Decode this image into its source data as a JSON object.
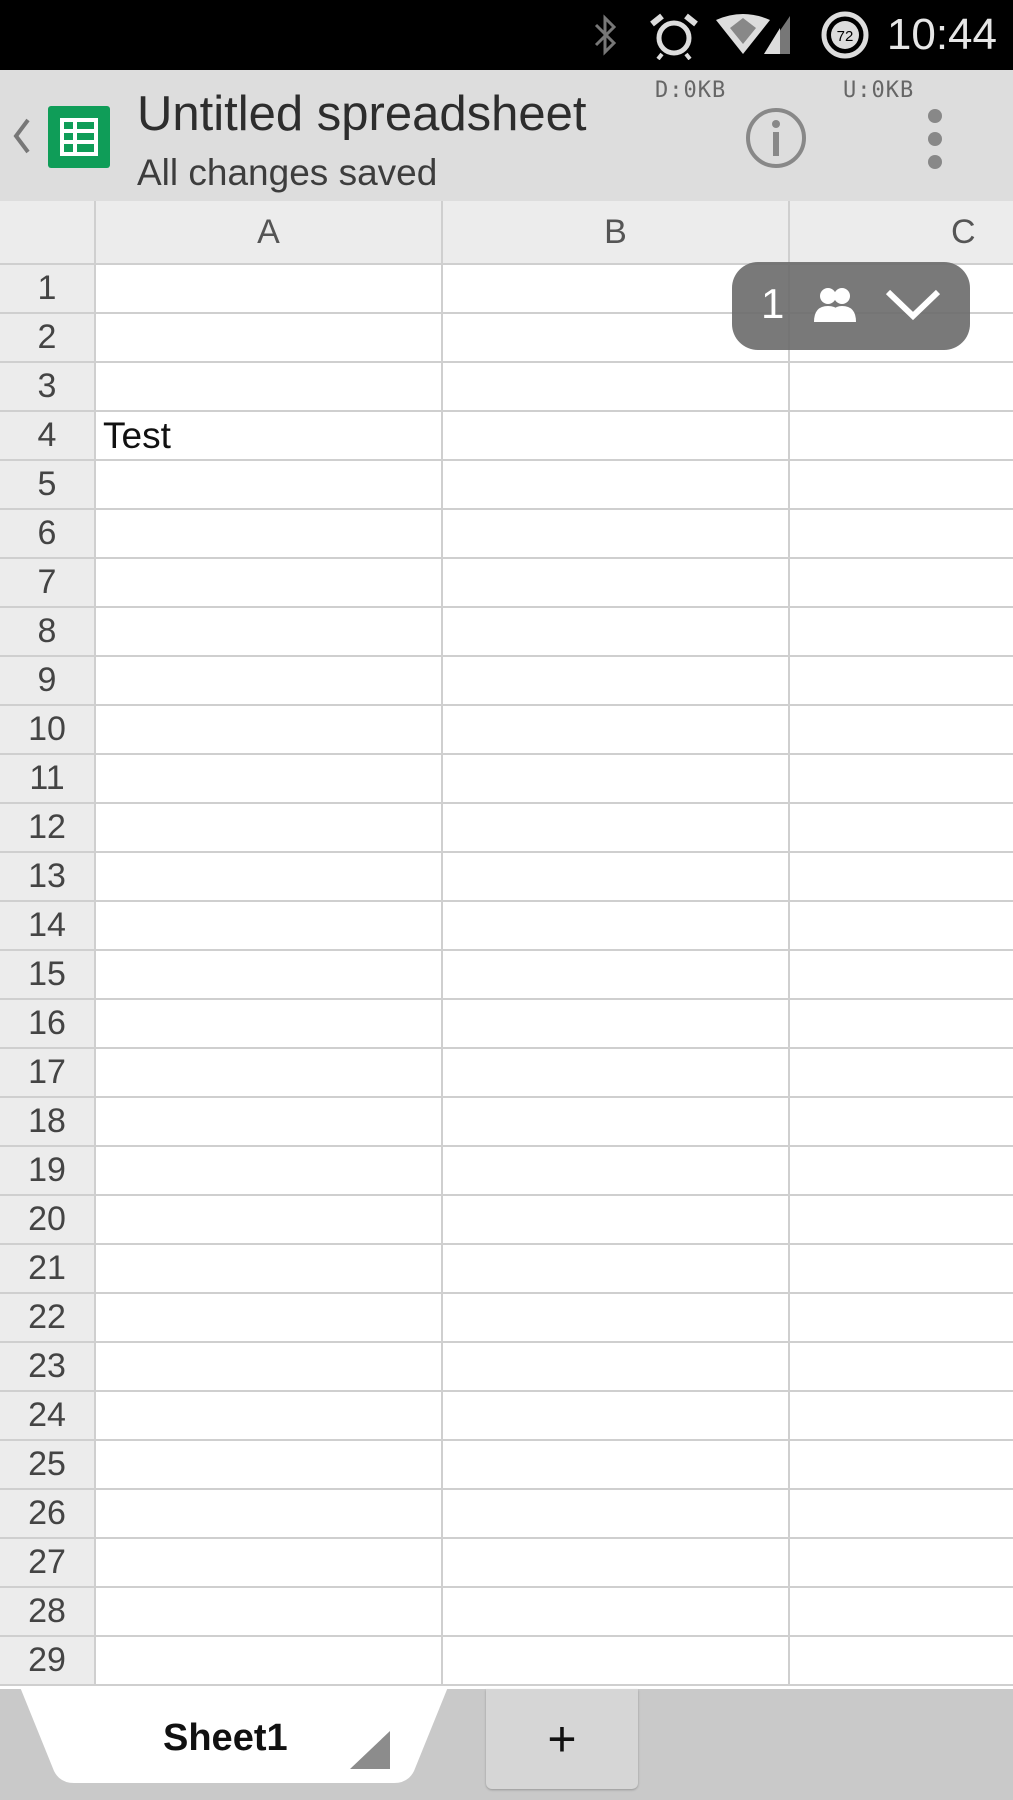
{
  "status_bar": {
    "time": "10:44",
    "battery_level": "72",
    "icons": [
      "bluetooth-icon",
      "alarm-icon",
      "wifi-icon",
      "signal-icon",
      "battery-icon"
    ]
  },
  "action_bar": {
    "title": "Untitled spreadsheet",
    "subtitle": "All changes saved",
    "download_label": "D:0KB",
    "upload_label": "U:0KB"
  },
  "grid": {
    "columns": [
      "A",
      "B",
      "C"
    ],
    "rows": [
      {
        "num": "1",
        "cells": [
          "",
          "",
          ""
        ]
      },
      {
        "num": "2",
        "cells": [
          "",
          "",
          ""
        ]
      },
      {
        "num": "3",
        "cells": [
          "",
          "",
          ""
        ]
      },
      {
        "num": "4",
        "cells": [
          "Test",
          "",
          ""
        ]
      },
      {
        "num": "5",
        "cells": [
          "",
          "",
          ""
        ]
      },
      {
        "num": "6",
        "cells": [
          "",
          "",
          ""
        ]
      },
      {
        "num": "7",
        "cells": [
          "",
          "",
          ""
        ]
      },
      {
        "num": "8",
        "cells": [
          "",
          "",
          ""
        ]
      },
      {
        "num": "9",
        "cells": [
          "",
          "",
          ""
        ]
      },
      {
        "num": "10",
        "cells": [
          "",
          "",
          ""
        ]
      },
      {
        "num": "11",
        "cells": [
          "",
          "",
          ""
        ]
      },
      {
        "num": "12",
        "cells": [
          "",
          "",
          ""
        ]
      },
      {
        "num": "13",
        "cells": [
          "",
          "",
          ""
        ]
      },
      {
        "num": "14",
        "cells": [
          "",
          "",
          ""
        ]
      },
      {
        "num": "15",
        "cells": [
          "",
          "",
          ""
        ]
      },
      {
        "num": "16",
        "cells": [
          "",
          "",
          ""
        ]
      },
      {
        "num": "17",
        "cells": [
          "",
          "",
          ""
        ]
      },
      {
        "num": "18",
        "cells": [
          "",
          "",
          ""
        ]
      },
      {
        "num": "19",
        "cells": [
          "",
          "",
          ""
        ]
      },
      {
        "num": "20",
        "cells": [
          "",
          "",
          ""
        ]
      },
      {
        "num": "21",
        "cells": [
          "",
          "",
          ""
        ]
      },
      {
        "num": "22",
        "cells": [
          "",
          "",
          ""
        ]
      },
      {
        "num": "23",
        "cells": [
          "",
          "",
          ""
        ]
      },
      {
        "num": "24",
        "cells": [
          "",
          "",
          ""
        ]
      },
      {
        "num": "25",
        "cells": [
          "",
          "",
          ""
        ]
      },
      {
        "num": "26",
        "cells": [
          "",
          "",
          ""
        ]
      },
      {
        "num": "27",
        "cells": [
          "",
          "",
          ""
        ]
      },
      {
        "num": "28",
        "cells": [
          "",
          "",
          ""
        ]
      },
      {
        "num": "29",
        "cells": [
          "",
          "",
          ""
        ]
      }
    ]
  },
  "collaborators": {
    "count": "1"
  },
  "sheets": {
    "tabs": [
      {
        "label": "Sheet1"
      }
    ],
    "add_label": "+"
  },
  "colors": {
    "brand_green": "#0f9d58",
    "action_bar_bg": "#dddddd",
    "header_bg": "#ececec",
    "gridline": "#cfcfcf"
  }
}
